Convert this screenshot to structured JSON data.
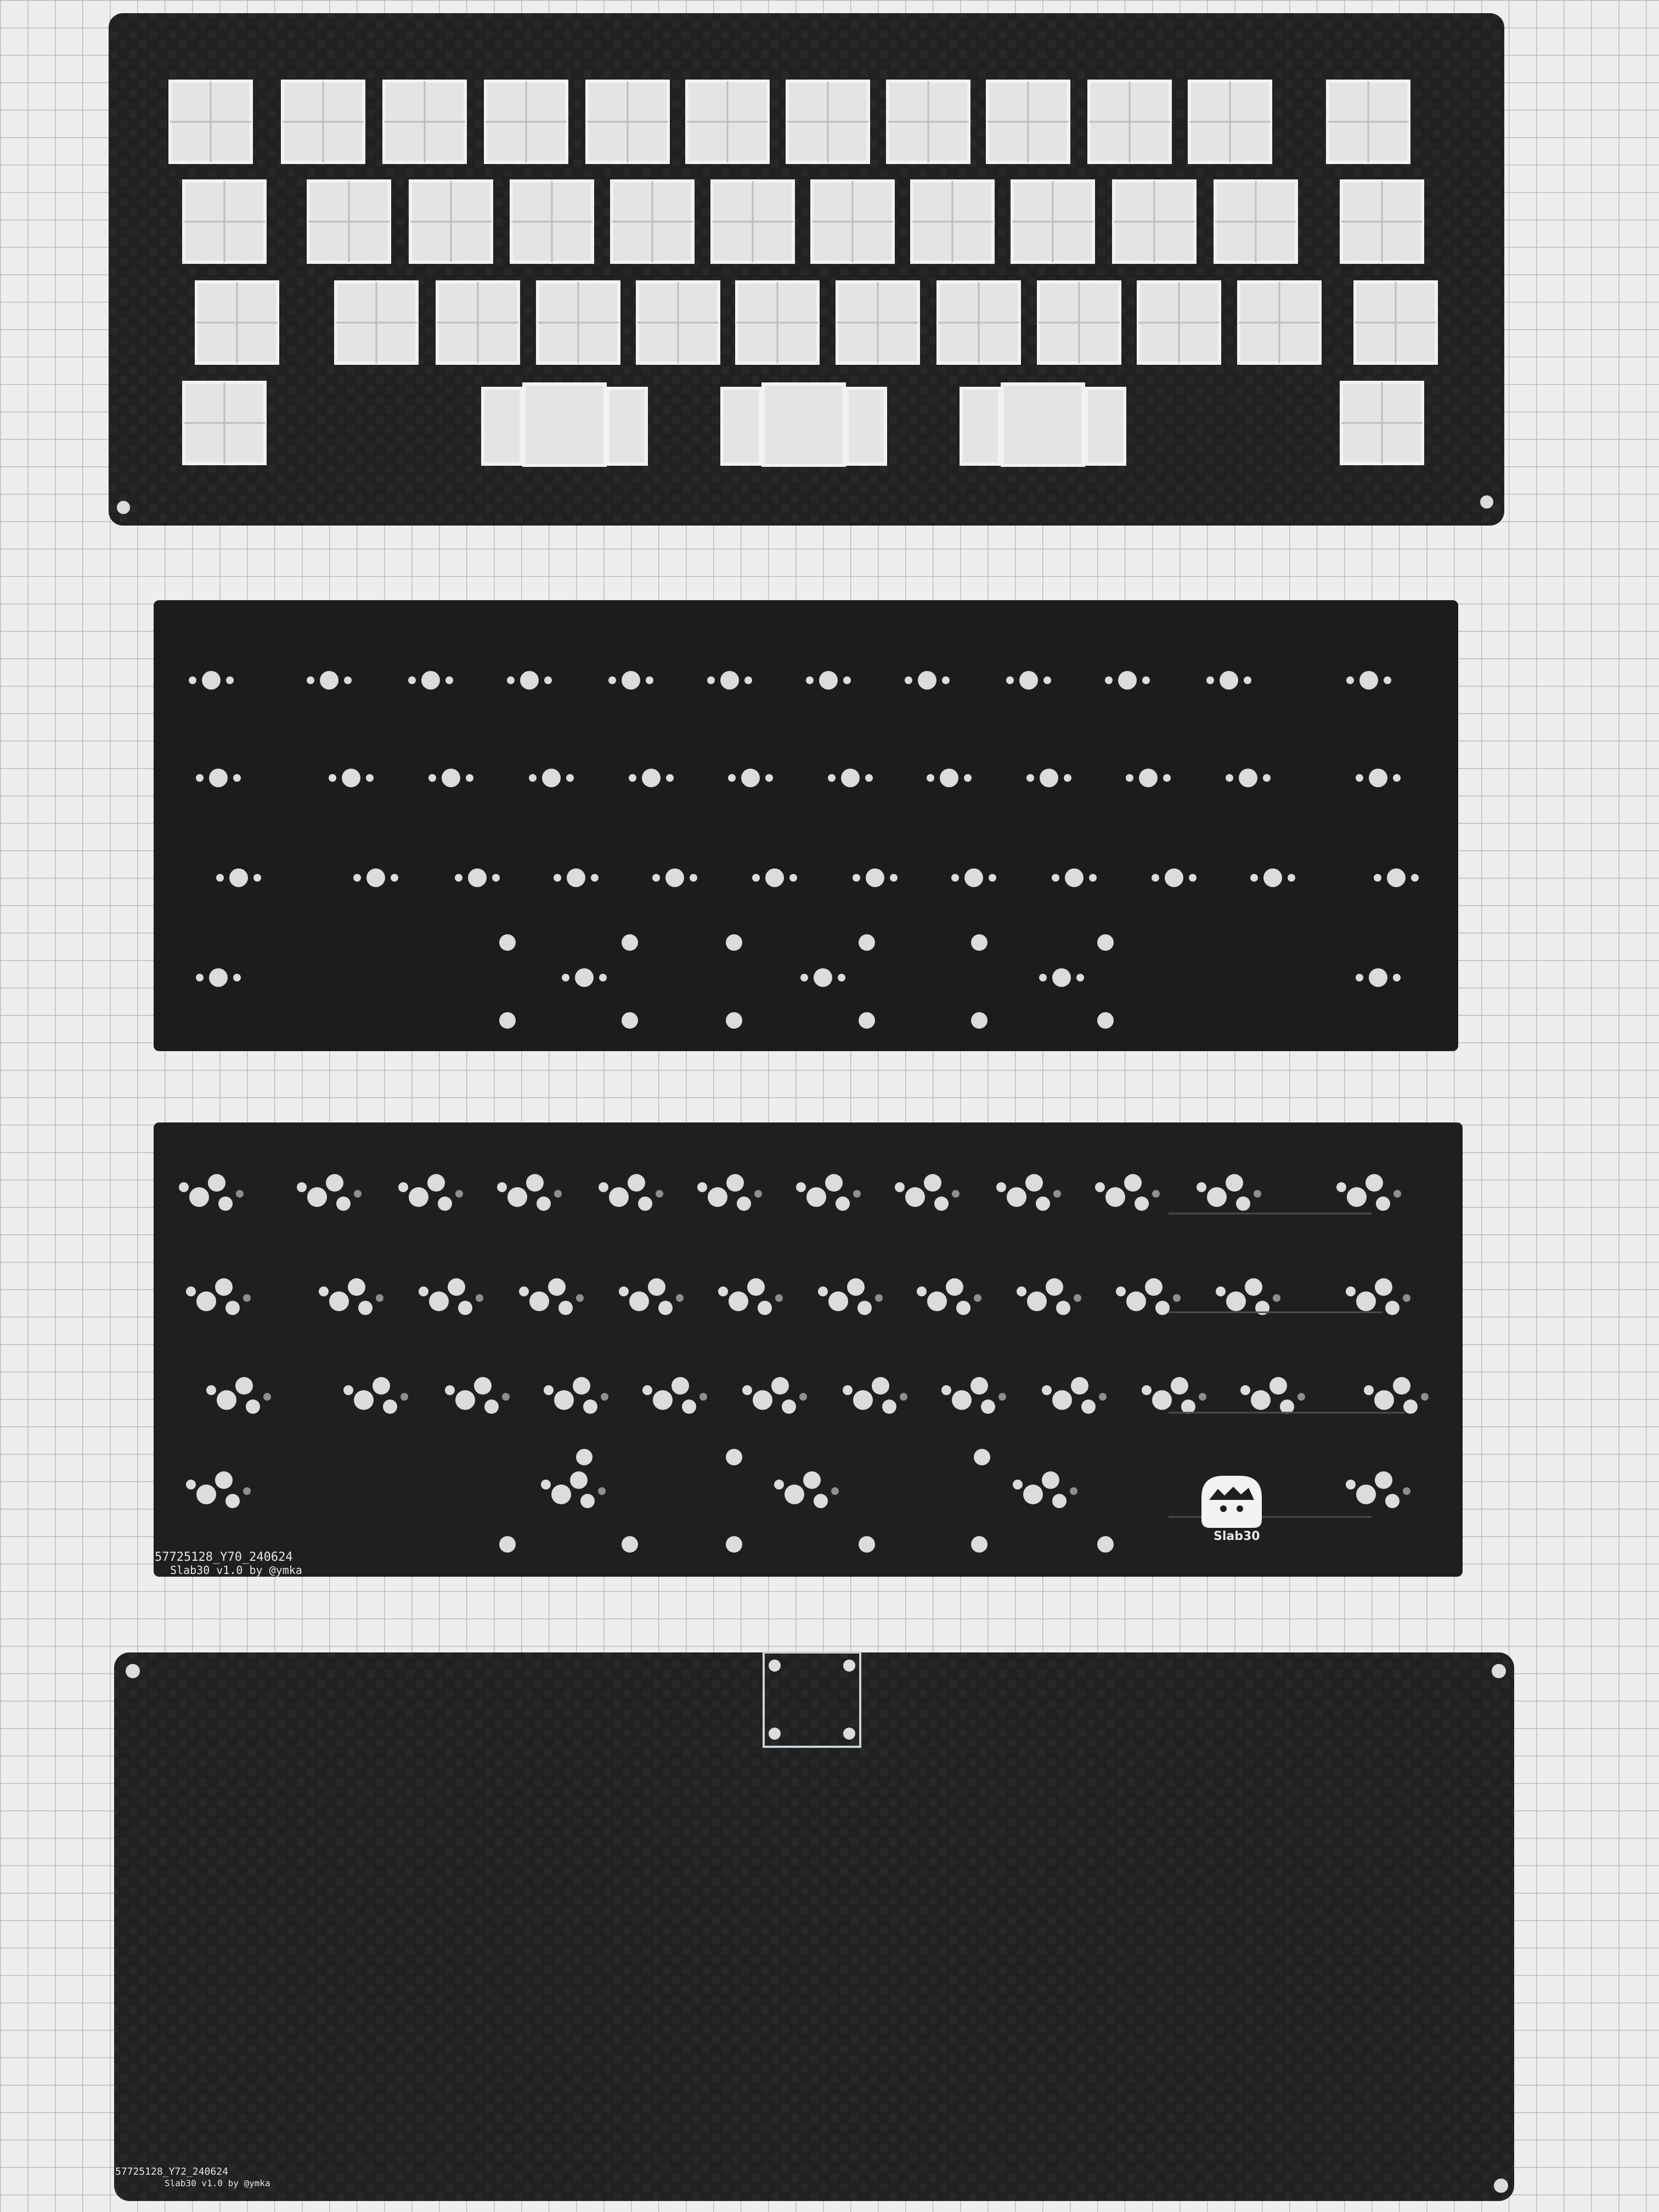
{
  "scene": {
    "background_color": "#eeeeec",
    "grid_color": "#bdbdbb",
    "panel_color": "#202122",
    "hole_color": "#dcdcda"
  },
  "pcb": {
    "code": "57725128_Y70_240624",
    "name": "Slab30 v1.0 by @ymka",
    "logo_text": "Slab30",
    "logo_icon": "keycap-creature-icon"
  },
  "bottom_plate": {
    "code": "57725128_Y72_240624",
    "name": "Slab30 v1.0 by @ymka"
  }
}
